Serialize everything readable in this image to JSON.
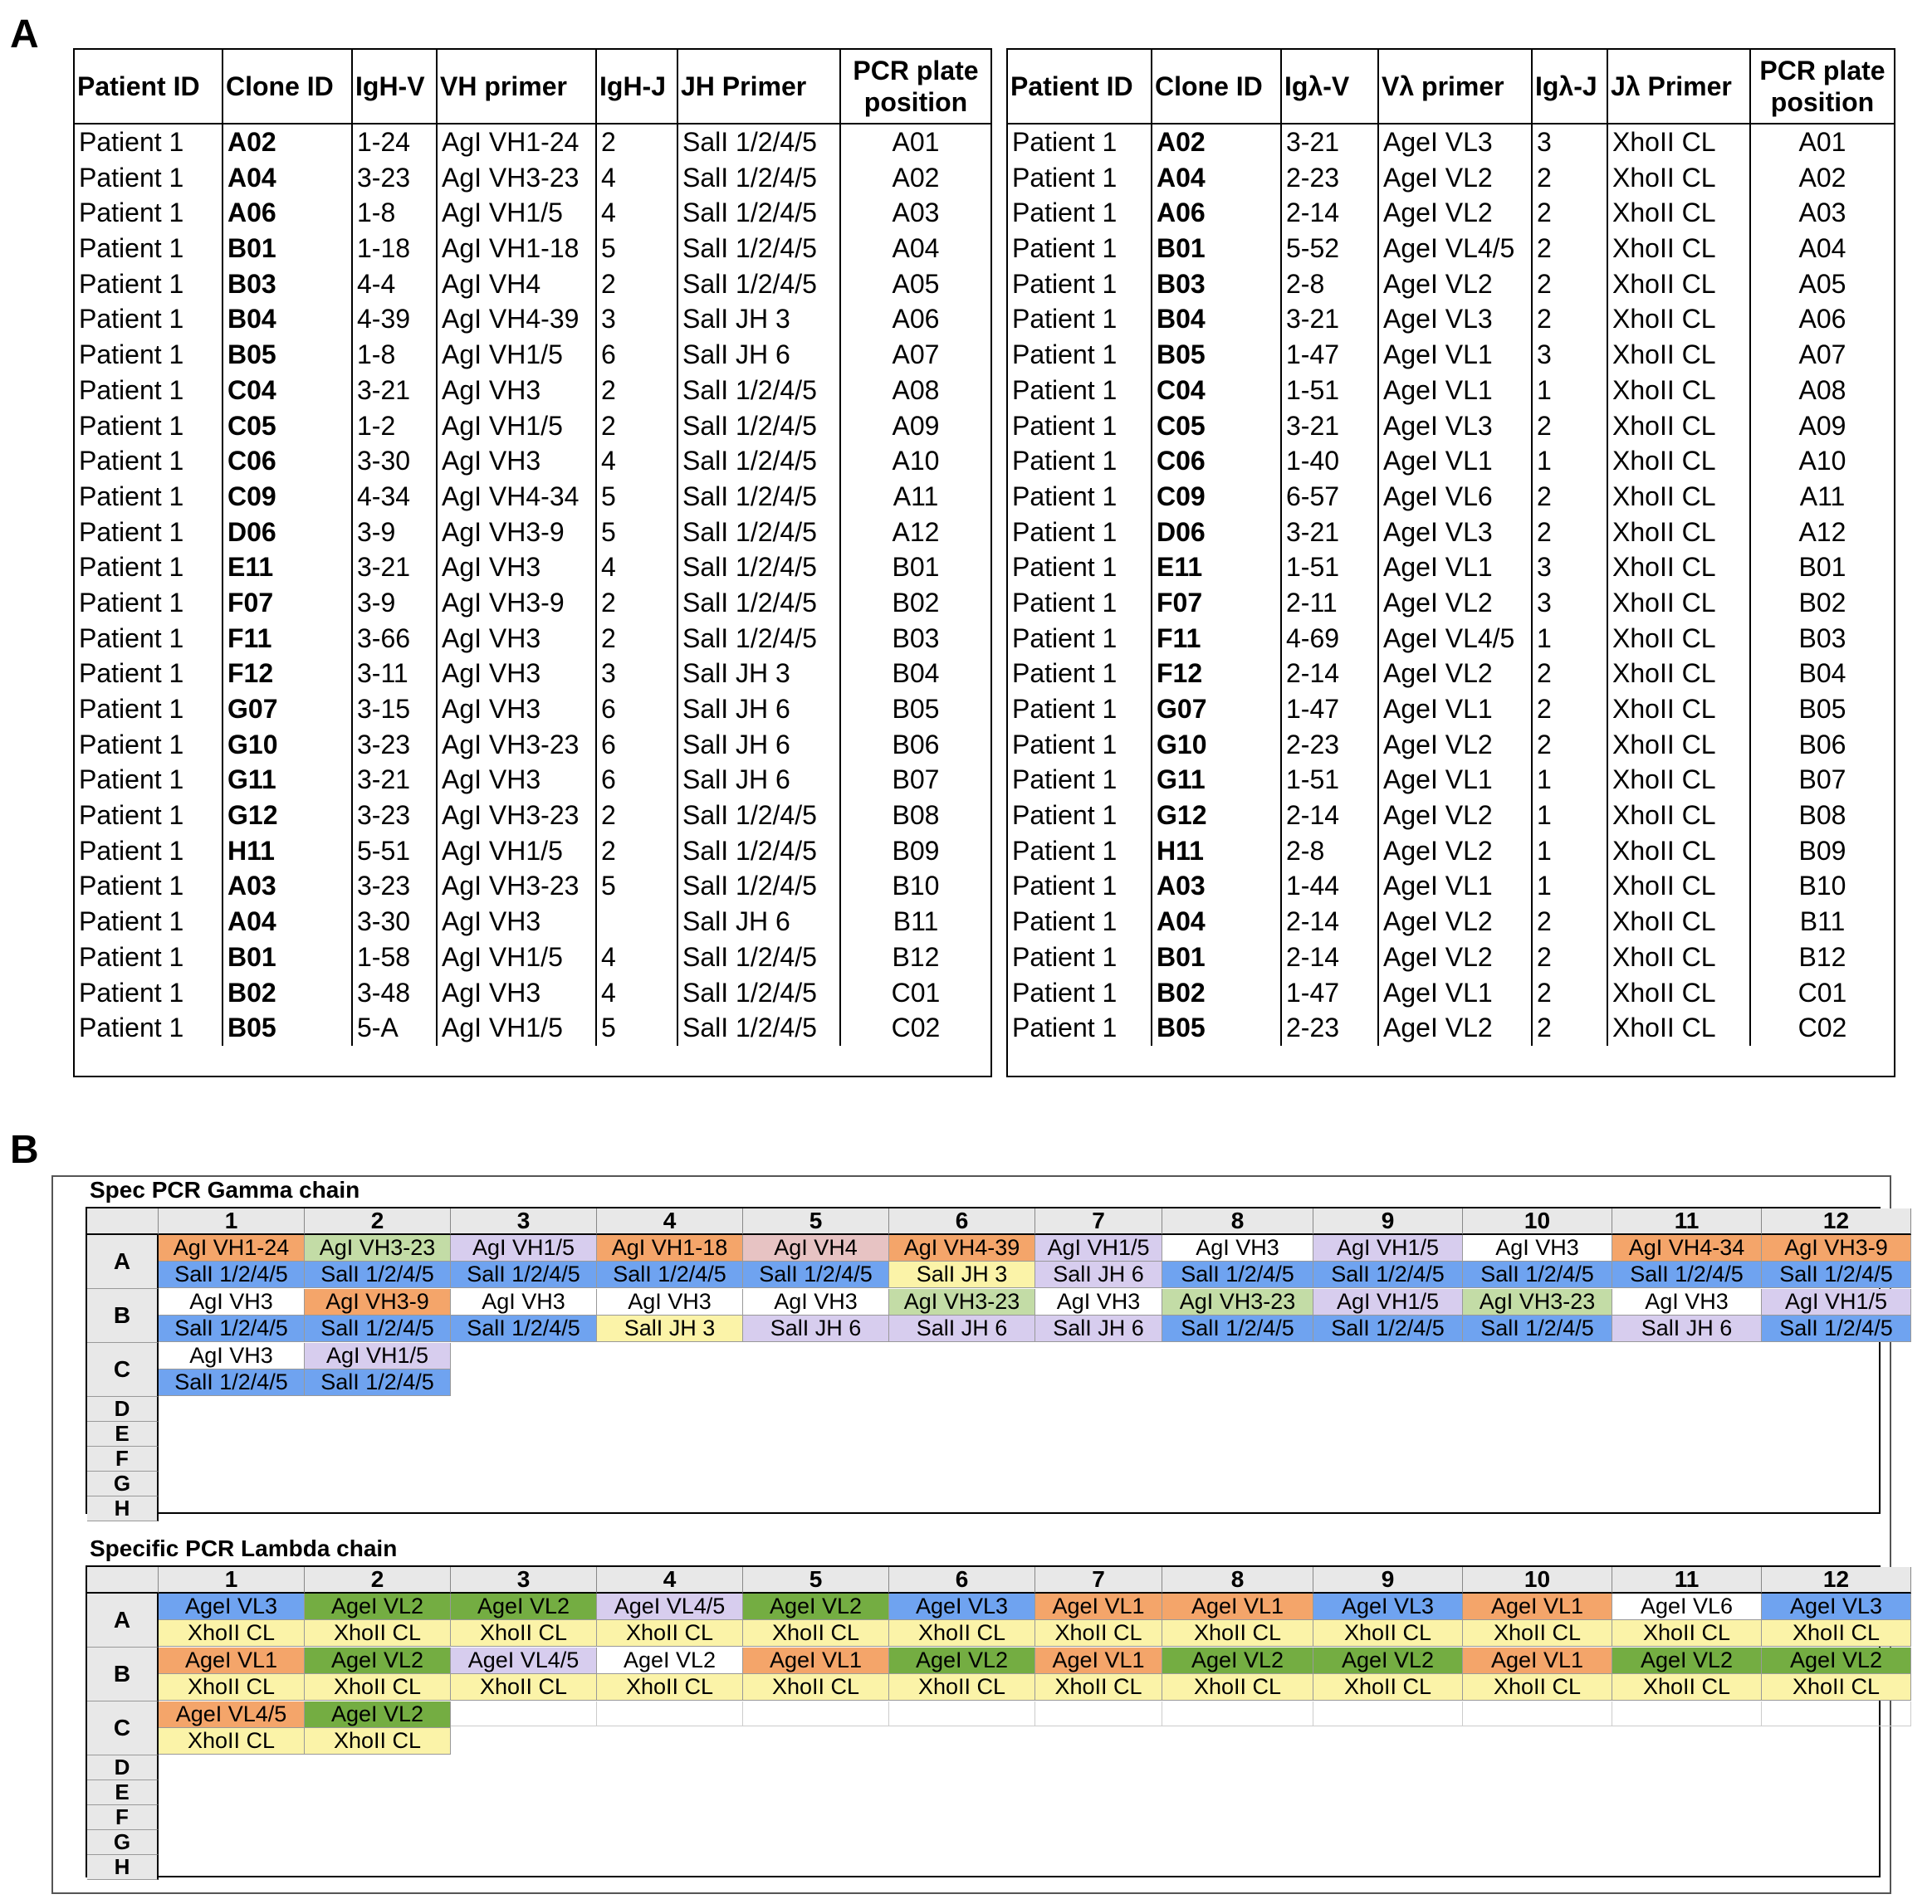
{
  "panel_labels": {
    "a": "A",
    "b": "B"
  },
  "heavy_table": {
    "headers": [
      "Patient ID",
      "Clone ID",
      "IgH-V",
      "VH primer",
      "IgH-J",
      "JH Primer",
      "PCR plate position"
    ],
    "rows": [
      [
        "Patient 1",
        "A02",
        "1-24",
        "AgI VH1-24",
        "2",
        "SalI 1/2/4/5",
        "A01"
      ],
      [
        "Patient 1",
        "A04",
        "3-23",
        "AgI VH3-23",
        "4",
        "SalI 1/2/4/5",
        "A02"
      ],
      [
        "Patient 1",
        "A06",
        "1-8",
        "AgI VH1/5",
        "4",
        "SalI 1/2/4/5",
        "A03"
      ],
      [
        "Patient 1",
        "B01",
        "1-18",
        "AgI VH1-18",
        "5",
        "SalI 1/2/4/5",
        "A04"
      ],
      [
        "Patient 1",
        "B03",
        "4-4",
        "AgI VH4",
        "2",
        "SalI 1/2/4/5",
        "A05"
      ],
      [
        "Patient 1",
        "B04",
        "4-39",
        "AgI VH4-39",
        "3",
        "SalI JH 3",
        "A06"
      ],
      [
        "Patient 1",
        "B05",
        "1-8",
        "AgI VH1/5",
        "6",
        "SalI JH 6",
        "A07"
      ],
      [
        "Patient 1",
        "C04",
        "3-21",
        "AgI VH3",
        "2",
        "SalI 1/2/4/5",
        "A08"
      ],
      [
        "Patient 1",
        "C05",
        "1-2",
        "AgI VH1/5",
        "2",
        "SalI 1/2/4/5",
        "A09"
      ],
      [
        "Patient 1",
        "C06",
        "3-30",
        "AgI VH3",
        "4",
        "SalI 1/2/4/5",
        "A10"
      ],
      [
        "Patient 1",
        "C09",
        "4-34",
        "AgI VH4-34",
        "5",
        "SalI 1/2/4/5",
        "A11"
      ],
      [
        "Patient 1",
        "D06",
        "3-9",
        "AgI VH3-9",
        "5",
        "SalI 1/2/4/5",
        "A12"
      ],
      [
        "Patient 1",
        "E11",
        "3-21",
        "AgI VH3",
        "4",
        "SalI 1/2/4/5",
        "B01"
      ],
      [
        "Patient 1",
        "F07",
        "3-9",
        "AgI VH3-9",
        "2",
        "SalI 1/2/4/5",
        "B02"
      ],
      [
        "Patient 1",
        "F11",
        "3-66",
        "AgI VH3",
        "2",
        "SalI 1/2/4/5",
        "B03"
      ],
      [
        "Patient 1",
        "F12",
        "3-11",
        "AgI VH3",
        "3",
        "SalI JH 3",
        "B04"
      ],
      [
        "Patient 1",
        "G07",
        "3-15",
        "AgI VH3",
        "6",
        "SalI JH 6",
        "B05"
      ],
      [
        "Patient 1",
        "G10",
        "3-23",
        "AgI VH3-23",
        "6",
        "SalI JH 6",
        "B06"
      ],
      [
        "Patient 1",
        "G11",
        "3-21",
        "AgI VH3",
        "6",
        "SalI JH 6",
        "B07"
      ],
      [
        "Patient 1",
        "G12",
        "3-23",
        "AgI VH3-23",
        "2",
        "SalI 1/2/4/5",
        "B08"
      ],
      [
        "Patient 1",
        "H11",
        "5-51",
        "AgI VH1/5",
        "2",
        "SalI 1/2/4/5",
        "B09"
      ],
      [
        "Patient 1",
        "A03",
        "3-23",
        "AgI VH3-23",
        "5",
        "SalI 1/2/4/5",
        "B10"
      ],
      [
        "Patient 1",
        "A04",
        "3-30",
        "AgI VH3",
        "",
        "SalI JH 6",
        "B11"
      ],
      [
        "Patient 1",
        "B01",
        "1-58",
        "AgI VH1/5",
        "4",
        "SalI 1/2/4/5",
        "B12"
      ],
      [
        "Patient 1",
        "B02",
        "3-48",
        "AgI VH3",
        "4",
        "SalI 1/2/4/5",
        "C01"
      ],
      [
        "Patient 1",
        "B05",
        "5-A",
        "AgI VH1/5",
        "5",
        "SalI 1/2/4/5",
        "C02"
      ]
    ]
  },
  "lambda_table": {
    "headers": [
      "Patient ID",
      "Clone ID",
      "Igλ-V",
      "Vλ primer",
      "Igλ-J",
      "Jλ Primer",
      "PCR plate position"
    ],
    "rows": [
      [
        "Patient 1",
        "A02",
        "3-21",
        "AgeI VL3",
        "3",
        "XhoII CL",
        "A01"
      ],
      [
        "Patient 1",
        "A04",
        "2-23",
        "AgeI VL2",
        "2",
        "XhoII CL",
        "A02"
      ],
      [
        "Patient 1",
        "A06",
        "2-14",
        "AgeI VL2",
        "2",
        "XhoII CL",
        "A03"
      ],
      [
        "Patient 1",
        "B01",
        "5-52",
        "AgeI VL4/5",
        "2",
        "XhoII CL",
        "A04"
      ],
      [
        "Patient 1",
        "B03",
        "2-8",
        "AgeI VL2",
        "2",
        "XhoII CL",
        "A05"
      ],
      [
        "Patient 1",
        "B04",
        "3-21",
        "AgeI VL3",
        "2",
        "XhoII CL",
        "A06"
      ],
      [
        "Patient 1",
        "B05",
        "1-47",
        "AgeI VL1",
        "3",
        "XhoII CL",
        "A07"
      ],
      [
        "Patient 1",
        "C04",
        "1-51",
        "AgeI VL1",
        "1",
        "XhoII CL",
        "A08"
      ],
      [
        "Patient 1",
        "C05",
        "3-21",
        "AgeI VL3",
        "2",
        "XhoII CL",
        "A09"
      ],
      [
        "Patient 1",
        "C06",
        "1-40",
        "AgeI VL1",
        "1",
        "XhoII CL",
        "A10"
      ],
      [
        "Patient 1",
        "C09",
        "6-57",
        "AgeI VL6",
        "2",
        "XhoII CL",
        "A11"
      ],
      [
        "Patient 1",
        "D06",
        "3-21",
        "AgeI VL3",
        "2",
        "XhoII CL",
        "A12"
      ],
      [
        "Patient 1",
        "E11",
        "1-51",
        "AgeI VL1",
        "3",
        "XhoII CL",
        "B01"
      ],
      [
        "Patient 1",
        "F07",
        "2-11",
        "AgeI VL2",
        "3",
        "XhoII CL",
        "B02"
      ],
      [
        "Patient 1",
        "F11",
        "4-69",
        "AgeI VL4/5",
        "1",
        "XhoII CL",
        "B03"
      ],
      [
        "Patient 1",
        "F12",
        "2-14",
        "AgeI VL2",
        "2",
        "XhoII CL",
        "B04"
      ],
      [
        "Patient 1",
        "G07",
        "1-47",
        "AgeI VL1",
        "2",
        "XhoII CL",
        "B05"
      ],
      [
        "Patient 1",
        "G10",
        "2-23",
        "AgeI VL2",
        "2",
        "XhoII CL",
        "B06"
      ],
      [
        "Patient 1",
        "G11",
        "1-51",
        "AgeI VL1",
        "1",
        "XhoII CL",
        "B07"
      ],
      [
        "Patient 1",
        "G12",
        "2-14",
        "AgeI VL2",
        "1",
        "XhoII CL",
        "B08"
      ],
      [
        "Patient 1",
        "H11",
        "2-8",
        "AgeI VL2",
        "1",
        "XhoII CL",
        "B09"
      ],
      [
        "Patient 1",
        "A03",
        "1-44",
        "AgeI VL1",
        "1",
        "XhoII CL",
        "B10"
      ],
      [
        "Patient 1",
        "A04",
        "2-14",
        "AgeI VL2",
        "2",
        "XhoII CL",
        "B11"
      ],
      [
        "Patient 1",
        "B01",
        "2-14",
        "AgeI VL2",
        "2",
        "XhoII CL",
        "B12"
      ],
      [
        "Patient 1",
        "B02",
        "1-47",
        "AgeI VL1",
        "2",
        "XhoII CL",
        "C01"
      ],
      [
        "Patient 1",
        "B05",
        "2-23",
        "AgeI VL2",
        "2",
        "XhoII CL",
        "C02"
      ]
    ]
  },
  "plate_columns": [
    "1",
    "2",
    "3",
    "4",
    "5",
    "6",
    "7",
    "8",
    "9",
    "10",
    "11",
    "12"
  ],
  "plate_rows": [
    "A",
    "B",
    "C",
    "D",
    "E",
    "F",
    "G",
    "H"
  ],
  "gamma_plate": {
    "title": "Spec PCR Gamma chain",
    "wells": {
      "A": [
        {
          "v": "AgI VH1-24",
          "vc": "#f4a56a",
          "j": "SalI 1/2/4/5",
          "jc": "#6fa3f0"
        },
        {
          "v": "AgI VH3-23",
          "vc": "#c3dca6",
          "j": "SalI 1/2/4/5",
          "jc": "#6fa3f0"
        },
        {
          "v": "AgI VH1/5",
          "vc": "#d7cdee",
          "j": "SalI 1/2/4/5",
          "jc": "#6fa3f0"
        },
        {
          "v": "AgI VH1-18",
          "vc": "#f4a56a",
          "j": "SalI 1/2/4/5",
          "jc": "#6fa3f0"
        },
        {
          "v": "AgI VH4",
          "vc": "#e7c3c3",
          "j": "SalI 1/2/4/5",
          "jc": "#6fa3f0"
        },
        {
          "v": "AgI VH4-39",
          "vc": "#f4a56a",
          "j": "SalI JH 3",
          "jc": "#fbf3a8"
        },
        {
          "v": "AgI VH1/5",
          "vc": "#d7cdee",
          "j": "SalI JH 6",
          "jc": "#d7cdee"
        },
        {
          "v": "AgI VH3",
          "vc": "#ffffff",
          "j": "SalI 1/2/4/5",
          "jc": "#6fa3f0"
        },
        {
          "v": "AgI VH1/5",
          "vc": "#d7cdee",
          "j": "SalI 1/2/4/5",
          "jc": "#6fa3f0"
        },
        {
          "v": "AgI VH3",
          "vc": "#ffffff",
          "j": "SalI 1/2/4/5",
          "jc": "#6fa3f0"
        },
        {
          "v": "AgI VH4-34",
          "vc": "#f4a56a",
          "j": "SalI 1/2/4/5",
          "jc": "#6fa3f0"
        },
        {
          "v": "AgI VH3-9",
          "vc": "#f4a56a",
          "j": "SalI 1/2/4/5",
          "jc": "#6fa3f0"
        }
      ],
      "B": [
        {
          "v": "AgI VH3",
          "vc": "#ffffff",
          "j": "SalI 1/2/4/5",
          "jc": "#6fa3f0"
        },
        {
          "v": "AgI VH3-9",
          "vc": "#f4a56a",
          "j": "SalI 1/2/4/5",
          "jc": "#6fa3f0"
        },
        {
          "v": "AgI VH3",
          "vc": "#ffffff",
          "j": "SalI 1/2/4/5",
          "jc": "#6fa3f0"
        },
        {
          "v": "AgI VH3",
          "vc": "#ffffff",
          "j": "SalI JH 3",
          "jc": "#fbf3a8"
        },
        {
          "v": "AgI VH3",
          "vc": "#ffffff",
          "j": "SalI JH 6",
          "jc": "#d7cdee"
        },
        {
          "v": "AgI VH3-23",
          "vc": "#c3dca6",
          "j": "SalI JH 6",
          "jc": "#d7cdee"
        },
        {
          "v": "AgI VH3",
          "vc": "#ffffff",
          "j": "SalI JH 6",
          "jc": "#d7cdee"
        },
        {
          "v": "AgI VH3-23",
          "vc": "#c3dca6",
          "j": "SalI 1/2/4/5",
          "jc": "#6fa3f0"
        },
        {
          "v": "AgI VH1/5",
          "vc": "#d7cdee",
          "j": "SalI 1/2/4/5",
          "jc": "#6fa3f0"
        },
        {
          "v": "AgI VH3-23",
          "vc": "#c3dca6",
          "j": "SalI 1/2/4/5",
          "jc": "#6fa3f0"
        },
        {
          "v": "AgI VH3",
          "vc": "#ffffff",
          "j": "SalI JH 6",
          "jc": "#d7cdee"
        },
        {
          "v": "AgI VH1/5",
          "vc": "#d7cdee",
          "j": "SalI 1/2/4/5",
          "jc": "#6fa3f0"
        }
      ],
      "C": [
        {
          "v": "AgI VH3",
          "vc": "#ffffff",
          "j": "SalI 1/2/4/5",
          "jc": "#6fa3f0"
        },
        {
          "v": "AgI VH1/5",
          "vc": "#d7cdee",
          "j": "SalI 1/2/4/5",
          "jc": "#6fa3f0"
        }
      ]
    }
  },
  "lambda_plate": {
    "title": "Specific PCR Lambda chain",
    "wells": {
      "A": [
        {
          "v": "AgeI VL3",
          "vc": "#6fa3f0",
          "j": "XhoII CL",
          "jc": "#fbf3a8"
        },
        {
          "v": "AgeI VL2",
          "vc": "#74ad42",
          "j": "XhoII CL",
          "jc": "#fbf3a8"
        },
        {
          "v": "AgeI VL2",
          "vc": "#74ad42",
          "j": "XhoII CL",
          "jc": "#fbf3a8"
        },
        {
          "v": "AgeI VL4/5",
          "vc": "#d7cdee",
          "j": "XhoII CL",
          "jc": "#fbf3a8"
        },
        {
          "v": "AgeI VL2",
          "vc": "#74ad42",
          "j": "XhoII CL",
          "jc": "#fbf3a8"
        },
        {
          "v": "AgeI VL3",
          "vc": "#6fa3f0",
          "j": "XhoII CL",
          "jc": "#fbf3a8"
        },
        {
          "v": "AgeI VL1",
          "vc": "#f4a56a",
          "j": "XhoII CL",
          "jc": "#fbf3a8"
        },
        {
          "v": "AgeI VL1",
          "vc": "#f4a56a",
          "j": "XhoII CL",
          "jc": "#fbf3a8"
        },
        {
          "v": "AgeI VL3",
          "vc": "#6fa3f0",
          "j": "XhoII CL",
          "jc": "#fbf3a8"
        },
        {
          "v": "AgeI VL1",
          "vc": "#f4a56a",
          "j": "XhoII CL",
          "jc": "#fbf3a8"
        },
        {
          "v": "AgeI VL6",
          "vc": "#ffffff",
          "j": "XhoII CL",
          "jc": "#fbf3a8"
        },
        {
          "v": "AgeI VL3",
          "vc": "#6fa3f0",
          "j": "XhoII CL",
          "jc": "#fbf3a8"
        }
      ],
      "B": [
        {
          "v": "AgeI VL1",
          "vc": "#f4a56a",
          "j": "XhoII CL",
          "jc": "#fbf3a8"
        },
        {
          "v": "AgeI VL2",
          "vc": "#74ad42",
          "j": "XhoII CL",
          "jc": "#fbf3a8"
        },
        {
          "v": "AgeI VL4/5",
          "vc": "#d7cdee",
          "j": "XhoII CL",
          "jc": "#fbf3a8"
        },
        {
          "v": "AgeI VL2",
          "vc": "#ffffff",
          "j": "XhoII CL",
          "jc": "#fbf3a8"
        },
        {
          "v": "AgeI VL1",
          "vc": "#f4a56a",
          "j": "XhoII CL",
          "jc": "#fbf3a8"
        },
        {
          "v": "AgeI VL2",
          "vc": "#74ad42",
          "j": "XhoII CL",
          "jc": "#fbf3a8"
        },
        {
          "v": "AgeI VL1",
          "vc": "#f4a56a",
          "j": "XhoII CL",
          "jc": "#fbf3a8"
        },
        {
          "v": "AgeI VL2",
          "vc": "#74ad42",
          "j": "XhoII CL",
          "jc": "#fbf3a8"
        },
        {
          "v": "AgeI VL2",
          "vc": "#74ad42",
          "j": "XhoII CL",
          "jc": "#fbf3a8"
        },
        {
          "v": "AgeI VL1",
          "vc": "#f4a56a",
          "j": "XhoII CL",
          "jc": "#fbf3a8"
        },
        {
          "v": "AgeI VL2",
          "vc": "#74ad42",
          "j": "XhoII CL",
          "jc": "#fbf3a8"
        },
        {
          "v": "AgeI VL2",
          "vc": "#74ad42",
          "j": "XhoII CL",
          "jc": "#fbf3a8"
        }
      ],
      "C": [
        {
          "v": "AgeI VL4/5",
          "vc": "#f4a56a",
          "j": "XhoII CL",
          "jc": "#fbf3a8"
        },
        {
          "v": "AgeI VL2",
          "vc": "#74ad42",
          "j": "XhoII CL",
          "jc": "#fbf3a8"
        }
      ]
    }
  }
}
